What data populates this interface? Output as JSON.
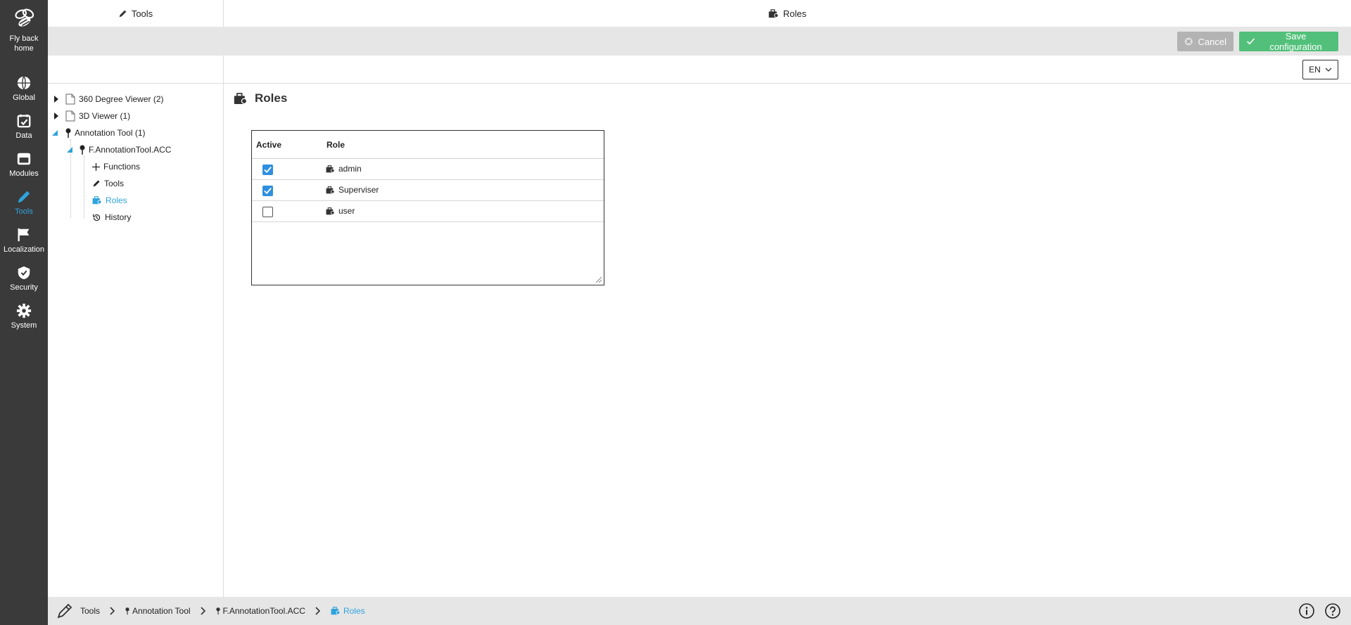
{
  "nav": {
    "home_label": "Fly back home",
    "items": [
      {
        "label": "Global",
        "icon": "globe-icon"
      },
      {
        "label": "Data",
        "icon": "calendar-check-icon"
      },
      {
        "label": "Modules",
        "icon": "module-box-icon"
      },
      {
        "label": "Tools",
        "icon": "pencil-icon",
        "active": true
      },
      {
        "label": "Localization",
        "icon": "flag-icon"
      },
      {
        "label": "Security",
        "icon": "shield-check-icon"
      },
      {
        "label": "System",
        "icon": "gear-icon"
      }
    ]
  },
  "header": {
    "left_title": "Tools",
    "right_title": "Roles"
  },
  "toolbar": {
    "cancel_label": "Cancel",
    "save_label": "Save configuration",
    "language": "EN"
  },
  "tree": [
    {
      "label": "360 Degree Viewer (2)",
      "icon": "document-icon"
    },
    {
      "label": "3D Viewer (1)",
      "icon": "document-icon"
    },
    {
      "label": "Annotation Tool (1)",
      "icon": "pin-icon"
    },
    {
      "label": "F.AnnotationTool.ACC",
      "icon": "pin-icon"
    },
    {
      "label": "Functions",
      "icon": "plus-icon"
    },
    {
      "label": "Tools",
      "icon": "pencil-icon"
    },
    {
      "label": "Roles",
      "icon": "roles-icon",
      "active": true
    },
    {
      "label": "History",
      "icon": "history-icon"
    }
  ],
  "main": {
    "title": "Roles",
    "columns": [
      "Active",
      "Role"
    ],
    "rows": [
      {
        "role": "admin",
        "active": true
      },
      {
        "role": "Superviser",
        "active": true
      },
      {
        "role": "user",
        "active": false
      }
    ]
  },
  "breadcrumb": [
    "Tools",
    "Annotation Tool",
    "F.AnnotationTool.ACC",
    "Roles"
  ],
  "colors": {
    "accent": "#2fa3dc",
    "nav_bg": "#3a3a3a",
    "save": "#52c07a",
    "cancel": "#b3b3b3",
    "checkbox": "#2f8fe0"
  }
}
